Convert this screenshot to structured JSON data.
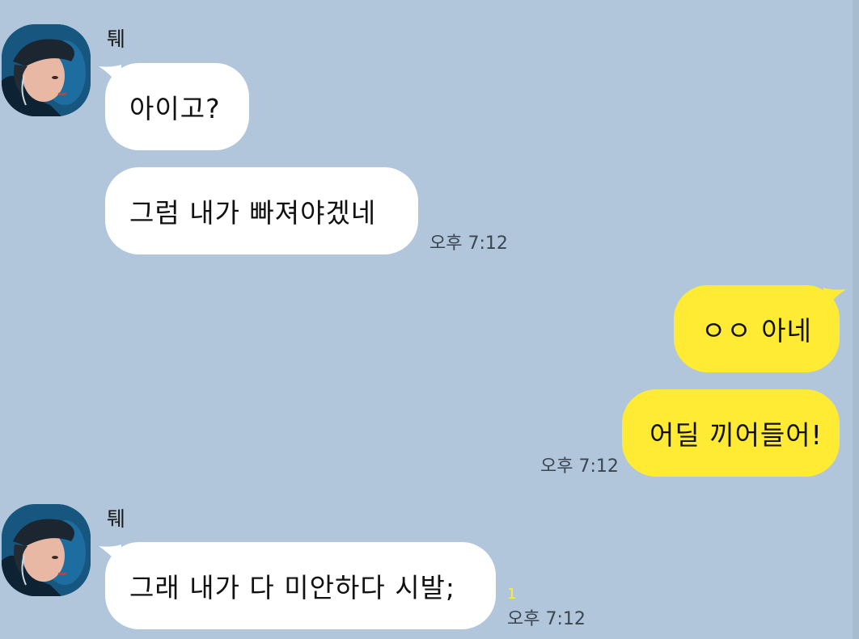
{
  "chat": {
    "groups": [
      {
        "sender": "퉤",
        "avatar_icon": "profile-photo-icon",
        "messages": [
          "아이고?",
          "그럼 내가 빠져야겠네"
        ],
        "time": "오후 7:12"
      },
      {
        "sender": "me",
        "messages": [
          "ㅇㅇ 아네",
          "어딜 끼어들어!"
        ],
        "time": "오후 7:12"
      },
      {
        "sender": "퉤",
        "avatar_icon": "profile-photo-icon",
        "messages": [
          "그래 내가 다 미안하다 시발;"
        ],
        "unread_count": "1",
        "time": "오후 7:12"
      }
    ]
  },
  "colors": {
    "background": "#b1c6da",
    "incoming_bubble": "#ffffff",
    "outgoing_bubble": "#ffeb33",
    "unread": "#ffea34"
  }
}
